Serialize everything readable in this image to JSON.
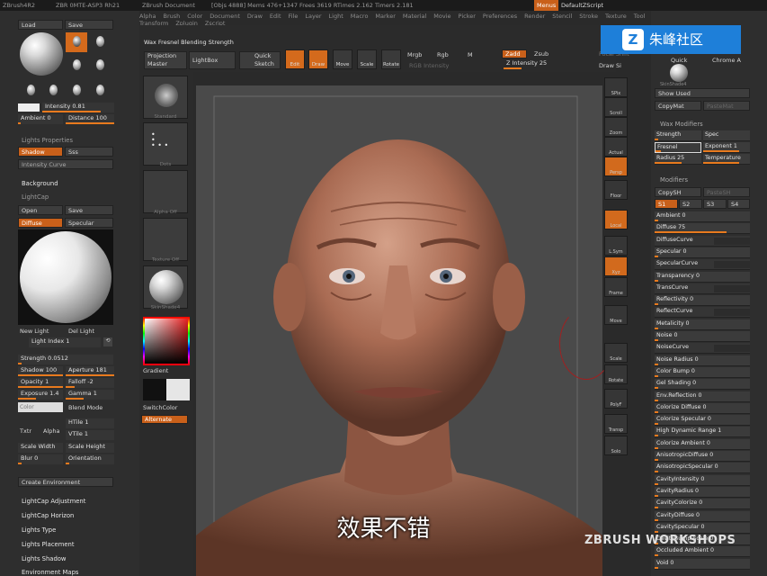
{
  "titlebar": {
    "app": "ZBrush4R2",
    "build": "ZBR 0MTE-ASP3 Rh21",
    "document": "ZBrush Document",
    "stats": "[Objs 4888] Mems 476+1347 Frees 3619 RTimes 2.162 Timers 2.181",
    "menus_btn": "Menus",
    "script": "DefaultZScript"
  },
  "menubar": [
    "Alpha",
    "Brush",
    "Color",
    "Document",
    "Draw",
    "Edit",
    "File",
    "Layer",
    "Light",
    "Macro",
    "Marker",
    "Material",
    "Movie",
    "Picker",
    "Preferences",
    "Render",
    "Stencil",
    "Stroke",
    "Texture",
    "Tool",
    "Transform",
    "Zplugin",
    "Zscript"
  ],
  "shelf": {
    "current": "Wax Fresnel Blending Strength",
    "projection_master": "Projection Master",
    "lightbox": "LightBox",
    "quick_sketch": "Quick Sketch",
    "edit": "Edit",
    "draw": "Draw",
    "move": "Move",
    "scale": "Scale",
    "rotate": "Rotate",
    "mrgb": "Mrgb",
    "rgb": "Rgb",
    "m": "M",
    "rgb_intensity": "RGB Intensity",
    "zadd": "Zadd",
    "zsub": "Zsub",
    "z_intensity": "Z Intensity 25",
    "focal_shift": "Focal Shift",
    "draw_size": "Draw Si"
  },
  "light": {
    "load": "Load",
    "save": "Save",
    "intensity": "Intensity 0.81",
    "intensity_val": 0.81,
    "ambient": "Ambient 0",
    "distance": "Distance 100",
    "lights_properties": "Lights Properties",
    "shadow": "Shadow",
    "sss": "Sss",
    "intensity_curve": "Intensity Curve",
    "background": "Background",
    "lightcap": "LightCap",
    "open": "Open",
    "save2": "Save",
    "diffuse": "Diffuse",
    "specular": "Specular",
    "new_light": "New Light",
    "del_light": "Del Light",
    "light_index": "Light Index 1",
    "strength": "Strength 0.0512",
    "shadow_val": "Shadow 100",
    "aperture": "Aperture 181",
    "opacity": "Opacity 1",
    "falloff": "Falloff -2",
    "exposure": "Exposure 1.4",
    "gamma": "Gamma 1",
    "color": "Color",
    "blend_mode": "Blend Mode",
    "txtr": "Txtr",
    "alpha": "Alpha",
    "htile": "HTile 1",
    "vtile": "VTile 1",
    "scale_width": "Scale Width",
    "scale_height": "Scale Height",
    "blur": "Blur 0",
    "orientation": "Orientation",
    "create_env": "Create Environment",
    "lightcap_adjustment": "LightCap Adjustment",
    "lightcap_horizon": "LightCap Horizon",
    "lights_type": "Lights Type",
    "lights_placement": "Lights Placement",
    "lights_shadow": "Lights Shadow",
    "environment_maps": "Environment Maps"
  },
  "tray": {
    "gradient": "Gradient",
    "switch_color": "SwitchColor",
    "alternate": "Alternate",
    "tile_labels": [
      "Standard",
      "Dots",
      "Alpha Off",
      "Texture Off",
      "SkinShade4"
    ]
  },
  "vtools": [
    "SPix",
    "Scroll",
    "Zoom",
    "Actual",
    "Persp",
    "Floor",
    "Local",
    "L.Sym",
    "Xyz",
    "Frame",
    "Move",
    "Scale",
    "Rotate",
    "PolyF",
    "Transp",
    "Solo"
  ],
  "right": {
    "quick": "Quick",
    "chrome": "Chrome A",
    "skin_material": "SkinShade4",
    "show_used": "Show Used",
    "copymat": "CopyMat",
    "pastemat": "PasteMat",
    "wax_modifiers": "Wax Modifiers",
    "w_strength": "Strength",
    "w_spec": "Spec",
    "w_fresnel": "Fresnel",
    "w_exponent": "Exponent 1",
    "w_radius": "Radius 25",
    "w_temperature": "Temperature",
    "modifiers": "Modifiers",
    "copysh": "CopySH",
    "pastesh": "PasteSH",
    "s1": "S1",
    "s2": "S2",
    "s3": "S3",
    "s4": "S4",
    "sliders": [
      {
        "label": "Ambient 0",
        "value": 0,
        "accent": true
      },
      {
        "label": "Diffuse 75",
        "value": 0.75,
        "accent": true
      },
      {
        "label": "DiffuseCurve",
        "value": 0,
        "accent": false,
        "curve": true
      },
      {
        "label": "Specular 0",
        "value": 0,
        "accent": true
      },
      {
        "label": "SpecularCurve",
        "value": 0,
        "accent": false,
        "curve": true
      },
      {
        "label": "Transparency 0",
        "value": 0,
        "accent": true
      },
      {
        "label": "TransCurve",
        "value": 0,
        "accent": false,
        "curve": true
      },
      {
        "label": "Reflectivity 0",
        "value": 0,
        "accent": true
      },
      {
        "label": "ReflectCurve",
        "value": 0,
        "accent": false,
        "curve": true
      },
      {
        "label": "Metalicity 0",
        "value": 0,
        "accent": true
      },
      {
        "label": "Noise 0",
        "value": 0,
        "accent": true
      },
      {
        "label": "NoiseCurve",
        "value": 0,
        "accent": false,
        "curve": true
      },
      {
        "label": "Noise Radius 0",
        "value": 0,
        "accent": true
      },
      {
        "label": "Color Bump 0",
        "value": 0,
        "accent": true
      },
      {
        "label": "Gel Shading 0",
        "value": 0,
        "accent": true
      },
      {
        "label": "Env.Reflection 0",
        "value": 0,
        "accent": true
      },
      {
        "label": "Colorize Diffuse 0",
        "value": 0,
        "accent": true
      },
      {
        "label": "Colorize Specular 0",
        "value": 0,
        "accent": true
      },
      {
        "label": "High Dynamic Range 1",
        "value": 0,
        "accent": true
      },
      {
        "label": "Colorize Ambient 0",
        "value": 0,
        "accent": true
      },
      {
        "label": "AnisotropicDiffuse 0",
        "value": 0,
        "accent": true
      },
      {
        "label": "AnisotropicSpecular 0",
        "value": 0,
        "accent": true
      },
      {
        "label": "CavityIntensity 0",
        "value": 0,
        "accent": true
      },
      {
        "label": "CavityRadius 0",
        "value": 0,
        "accent": true
      },
      {
        "label": "CavityColorize 0",
        "value": 0,
        "accent": true
      },
      {
        "label": "CavityDiffuse 0",
        "value": 0,
        "accent": true
      },
      {
        "label": "CavitySpecular 0",
        "value": 0,
        "accent": true
      },
      {
        "label": "CavityBump Scale 0",
        "value": 0,
        "accent": true
      },
      {
        "label": "Occluded Ambient 0",
        "value": 0,
        "accent": true
      },
      {
        "label": "Void 0",
        "value": 0,
        "accent": true
      }
    ]
  },
  "watermark": "朱峰社区",
  "subtitle": "效果不错",
  "brand": "ZBRUSH WORKSHOPS",
  "colors": {
    "accent": "#e87a1e",
    "bg": "#2e2e2e",
    "canvas": "#4a4a4a",
    "watermark": "#1e7fd9"
  }
}
